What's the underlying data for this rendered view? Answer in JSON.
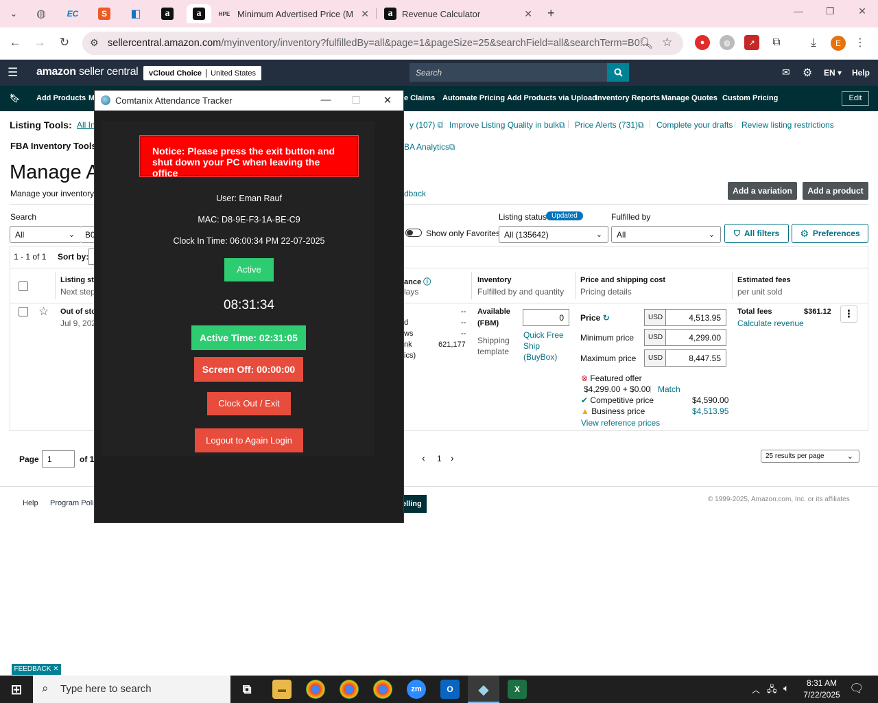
{
  "browser": {
    "tabs": [
      {
        "title": "Minimum Advertised Price (MA",
        "favicon": "hpe-icon"
      },
      {
        "title": "Revenue Calculator",
        "favicon": "amazon-icon"
      }
    ],
    "new_tab": "+",
    "url_domain": "sellercentral.amazon.com",
    "url_path": "/myinventory/inventory?fulfilledBy=all&page=1&pageSize=25&searchField=all&searchTerm=B0...",
    "profile_initial": "E"
  },
  "header": {
    "logo_bold": "amazon",
    "logo_light": "seller central",
    "store": "vCloud Choice",
    "region": "United States",
    "search_placeholder": "Search",
    "language": "EN",
    "help": "Help"
  },
  "nav": {
    "items": [
      "Add Products",
      "M",
      "e Claims",
      "Automate Pricing",
      "Add Products via Upload",
      "Inventory Reports",
      "Manage Quotes",
      "Custom Pricing"
    ],
    "edit": "Edit"
  },
  "tools": {
    "listing_tools_label": "Listing Tools:",
    "listing_tools_first": "All In",
    "links": [
      "y (107)",
      "Improve Listing Quality in bulk",
      "Price Alerts (731)",
      "Complete your drafts",
      "Review listing restrictions"
    ],
    "fba_label": "FBA Inventory Tools",
    "fba_link": "BA Analytics"
  },
  "page": {
    "title": "Manage A",
    "subtitle": "Manage your inventory a",
    "feedback_link": "dback",
    "add_variation": "Add a variation",
    "add_product": "Add a product"
  },
  "filters": {
    "search_label": "Search",
    "search_field": "All",
    "search_term": "B0",
    "favorites_label": "Show only Favorites",
    "listing_status_label": "Listing status",
    "updated_badge": "Updated",
    "listing_status_value": "All (135642)",
    "fulfilled_by_label": "Fulfilled by",
    "fulfilled_by_value": "All",
    "all_filters": "All filters",
    "preferences": "Preferences"
  },
  "table": {
    "result_count": "1 - 1 of 1",
    "sort_by": "Sort by:",
    "col_listing": "Listing sta",
    "col_listing_sub": "Next step",
    "col_perf": "ance",
    "col_perf_sub": "lays",
    "col_inventory": "Inventory",
    "col_inventory_sub": "Fulfilled by and quantity",
    "col_price": "Price and shipping cost",
    "col_price_sub": "Pricing details",
    "col_fees": "Estimated fees",
    "col_fees_sub": "per unit sold",
    "row": {
      "status": "Out of sto",
      "date": "Jul 9, 202",
      "perf_labels": [
        "d",
        "ws",
        "nk",
        "ics)"
      ],
      "perf_values": [
        "--",
        "--",
        "--",
        "621,177"
      ],
      "available_label": "Available",
      "fbm_label": "(FBM)",
      "qty": "0",
      "shipping_label": "Shipping",
      "template_label": "template",
      "shipping_link": [
        "Quick Free",
        "Ship",
        "(BuyBox)"
      ],
      "price_label": "Price",
      "min_label": "Minimum price",
      "max_label": "Maximum price",
      "currency": "USD",
      "price": "4,513.95",
      "min_price": "4,299.00",
      "max_price": "8,447.55",
      "featured_offer": "Featured offer",
      "featured_value": "$4,299.00 + $0.00",
      "match": "Match",
      "competitive_price": "Competitive price",
      "competitive_value": "$4,590.00",
      "business_price": "Business price",
      "business_value": "$4,513.95",
      "view_reference": "View reference prices",
      "total_fees": "Total fees",
      "total_fees_value": "$361.12",
      "calc_revenue": "Calculate revenue"
    }
  },
  "pagination": {
    "page_label": "Page",
    "page_value": "1",
    "of_label": "of 1",
    "current": "1",
    "per_page": "25 results per page"
  },
  "footer": {
    "help": "Help",
    "program_policies": "Program Polic",
    "selling": "elling",
    "copyright": "© 1999-2025, Amazon.com, Inc. or its affiliates"
  },
  "feedback": "FEEDBACK ✕",
  "overlay": {
    "title": "Comtanix Attendance Tracker",
    "notice": "Notice: Please press the exit button and shut down your PC when leaving the office",
    "user": "User: Eman Rauf",
    "mac": "MAC: D8-9E-F3-1A-BE-C9",
    "clock_in": "Clock In Time: 06:00:34 PM 22-07-2025",
    "status": "Active",
    "clock": "08:31:34",
    "active_time": "Active Time: 02:31:05",
    "screen_off": "Screen Off: 00:00:00",
    "clock_out": "Clock Out / Exit",
    "logout": "Logout to Again Login"
  },
  "taskbar": {
    "search_placeholder": "Type here to search",
    "time": "8:31 AM",
    "date": "7/22/2025"
  }
}
